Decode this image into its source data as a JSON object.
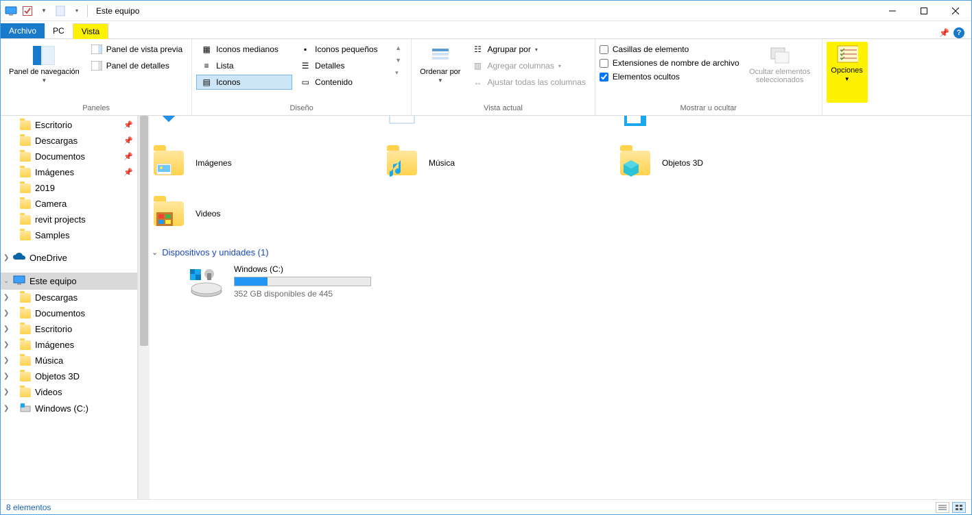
{
  "title": "Este equipo",
  "tabs": {
    "archivo": "Archivo",
    "pc": "PC",
    "vista": "Vista"
  },
  "ribbon": {
    "paneles": {
      "nav": "Panel de navegación",
      "preview": "Panel de vista previa",
      "details": "Panel de detalles",
      "group": "Paneles"
    },
    "diseno": {
      "iconos_medianos": "Iconos medianos",
      "iconos_pequenos": "Iconos pequeños",
      "lista": "Lista",
      "detalles": "Detalles",
      "iconos": "Iconos",
      "contenido": "Contenido",
      "group": "Diseño"
    },
    "vistaactual": {
      "ordenar": "Ordenar por",
      "agrupar": "Agrupar por",
      "agregar": "Agregar columnas",
      "ajustar": "Ajustar todas las columnas",
      "group": "Vista actual"
    },
    "mostrar": {
      "casillas": "Casillas de elemento",
      "ext": "Extensiones de nombre de archivo",
      "ocultos": "Elementos ocultos",
      "ocultarsel": "Ocultar elementos seleccionados",
      "group": "Mostrar u ocultar"
    },
    "opciones": "Opciones"
  },
  "nav": {
    "escritorio": "Escritorio",
    "descargas": "Descargas",
    "documentos": "Documentos",
    "imagenes": "Imágenes",
    "y2019": "2019",
    "camera": "Camera",
    "revit": "revit projects",
    "samples": "Samples",
    "onedrive": "OneDrive",
    "esteequipo": "Este equipo",
    "sub_descargas": "Descargas",
    "sub_documentos": "Documentos",
    "sub_escritorio": "Escritorio",
    "sub_imagenes": "Imágenes",
    "sub_musica": "Música",
    "sub_obj3d": "Objetos 3D",
    "sub_videos": "Videos",
    "sub_windowsc": "Windows (C:)"
  },
  "main": {
    "imagenes": "Imágenes",
    "musica": "Música",
    "objetos3d": "Objetos 3D",
    "videos": "Videos",
    "section_drives": "Dispositivos y unidades (1)",
    "drive_name": "Windows (C:)",
    "drive_sub": "352 GB disponibles de 445"
  },
  "status": {
    "count": "8 elementos"
  }
}
